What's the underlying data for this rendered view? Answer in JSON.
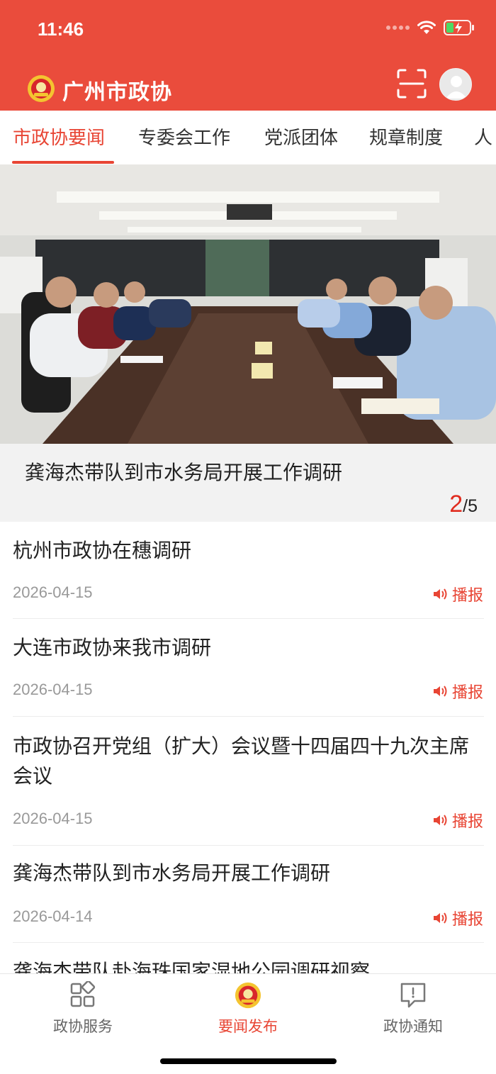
{
  "status_bar": {
    "time": "11:46"
  },
  "header": {
    "title": "广州市政协",
    "logo_icon": "cppcc-emblem-icon",
    "scan_icon": "scan-icon",
    "avatar_icon": "avatar-icon"
  },
  "tabs": [
    {
      "label": "市政协要闻",
      "active": true
    },
    {
      "label": "专委会工作",
      "active": false
    },
    {
      "label": "党派团体",
      "active": false
    },
    {
      "label": "规章制度",
      "active": false
    },
    {
      "label": "人",
      "active": false
    }
  ],
  "carousel": {
    "caption": "龚海杰带队到市水务局开展工作调研",
    "current": "2",
    "total": "/5"
  },
  "news": [
    {
      "title": "杭州市政协在穗调研",
      "date": "2026-04-15",
      "play_label": "播报"
    },
    {
      "title": "大连市政协来我市调研",
      "date": "2026-04-15",
      "play_label": "播报"
    },
    {
      "title": "市政协召开党组（扩大）会议暨十四届四十九次主席会议",
      "date": "2026-04-15",
      "play_label": "播报"
    },
    {
      "title": "龚海杰带队到市水务局开展工作调研",
      "date": "2026-04-14",
      "play_label": "播报"
    },
    {
      "title": "龚海杰带队赴海珠国家湿地公园调研视察",
      "date": "",
      "play_label": ""
    }
  ],
  "bottom_nav": [
    {
      "label": "政协服务",
      "icon": "grid-services-icon",
      "active": false
    },
    {
      "label": "要闻发布",
      "icon": "cppcc-emblem-icon",
      "active": true
    },
    {
      "label": "政协通知",
      "icon": "notice-bubble-icon",
      "active": false
    }
  ],
  "colors": {
    "brand_red": "#ea4c3c",
    "accent": "#e84534"
  }
}
